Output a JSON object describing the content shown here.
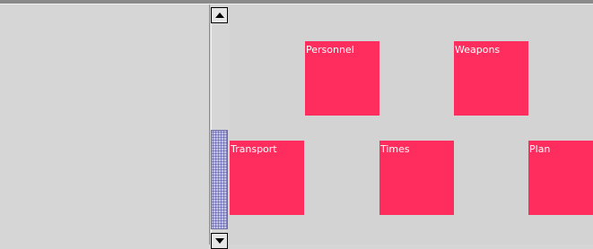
{
  "canvas": {
    "background_color": "#d3d3d3",
    "node_color": "#fe2d5e",
    "node_label_color": "#ffffff",
    "nodes": [
      {
        "label": "Personnel"
      },
      {
        "label": "Weapons"
      },
      {
        "label": "Transport"
      },
      {
        "label": "Times"
      },
      {
        "label": "Plan"
      }
    ]
  },
  "scrollbar": {
    "thumb_color": "#a9a9e0",
    "up_icon": "arrow-up-icon",
    "down_icon": "arrow-down-icon"
  }
}
